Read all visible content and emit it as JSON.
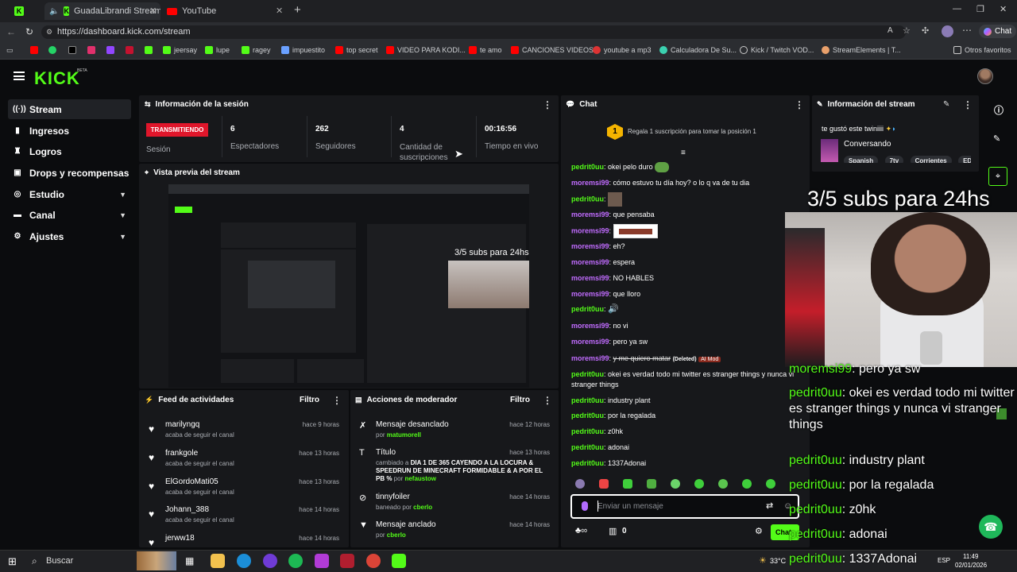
{
  "browser": {
    "tabs": [
      {
        "title": "GuadaLibrandi Stream - Watc",
        "icon": "kick-favicon"
      },
      {
        "title": "YouTube",
        "icon": "youtube-favicon"
      }
    ],
    "url": "https://dashboard.kick.com/stream",
    "bookmarks": [
      "jeersay",
      "lupe",
      "ragey",
      "impuestito",
      "top secret",
      "VIDEO PARA KODI...",
      "te amo",
      "CANCIONES VIDEOS",
      "youtube a mp3",
      "Calculadora De Su...",
      "Kick / Twitch VOD...",
      "StreamElements | T..."
    ],
    "other_bookmarks": "Otros favoritos",
    "chat_btn": "Chat"
  },
  "app": {
    "logo": "KICK",
    "beta": "BETA"
  },
  "sidebar": {
    "items": [
      {
        "label": "Stream",
        "icon": "stream-icon",
        "expand": false
      },
      {
        "label": "Ingresos",
        "icon": "revenue-icon",
        "expand": false
      },
      {
        "label": "Logros",
        "icon": "trophy-icon",
        "expand": false
      },
      {
        "label": "Drops y recompensas",
        "icon": "gift-icon",
        "expand": false
      },
      {
        "label": "Estudio",
        "icon": "studio-icon",
        "expand": true
      },
      {
        "label": "Canal",
        "icon": "channel-icon",
        "expand": true
      },
      {
        "label": "Ajustes",
        "icon": "gear-icon",
        "expand": true
      }
    ]
  },
  "session": {
    "title": "Información de la sesión",
    "status_badge": "TRANSMITIENDO",
    "session_label": "Sesión",
    "stats": [
      {
        "value": "6",
        "label": "Espectadores"
      },
      {
        "value": "262",
        "label": "Seguidores"
      },
      {
        "value": "4",
        "label": "Cantidad de suscripciones"
      },
      {
        "value": "00:16:56",
        "label": "Tiempo en vivo"
      }
    ]
  },
  "preview": {
    "title": "Vista previa del stream"
  },
  "activity": {
    "title": "Feed de actividades",
    "filter": "Filtro",
    "items": [
      {
        "name": "marilyngq",
        "action": "acaba de seguir el canal",
        "time": "hace 9 horas"
      },
      {
        "name": "frankgole",
        "action": "acaba de seguir el canal",
        "time": "hace 13 horas"
      },
      {
        "name": "ElGordoMati05",
        "action": "acaba de seguir el canal",
        "time": "hace 13 horas"
      },
      {
        "name": "Johann_388",
        "action": "acaba de seguir el canal",
        "time": "hace 14 horas"
      },
      {
        "name": "jerww18",
        "action": "",
        "time": "hace 14 horas"
      }
    ]
  },
  "moderation": {
    "title": "Acciones de moderador",
    "filter": "Filtro",
    "items": [
      {
        "title": "Mensaje desanclado",
        "pre": "por ",
        "user": "matumorell",
        "time": "hace 12 horas"
      },
      {
        "title": "Título",
        "pre": "cambiado a ",
        "bold": "DIA 1 DE 365 CAYENDO A LA LOCURA & SPEEDRUN DE MINECRAFT FORMIDABLE & A POR EL PB %",
        "mid": " por ",
        "user": "nefaustow",
        "time": "hace 13 horas"
      },
      {
        "title": "tinnyfoiler",
        "pre": "baneado por ",
        "user": "cberlo",
        "time": "hace 14 horas"
      },
      {
        "title": "Mensaje anclado",
        "pre": "por ",
        "user": "cberlo",
        "time": "hace 14 horas"
      }
    ]
  },
  "chat": {
    "title": "Chat",
    "gift_banner": "Regala 1 suscripción para tomar la posición 1",
    "rank": "1",
    "messages": [
      {
        "user": "pedrit0uu",
        "text": "okei pelo duro"
      },
      {
        "user": "moremsi99",
        "text": "cómo estuvo tu día hoy? o lo q va de tu dia"
      },
      {
        "user": "pedrit0uu",
        "text": ""
      },
      {
        "user": "moremsi99",
        "text": "que pensaba"
      },
      {
        "user": "moremsi99",
        "text": ""
      },
      {
        "user": "moremsi99",
        "text": "eh?"
      },
      {
        "user": "moremsi99",
        "text": "espera"
      },
      {
        "user": "moremsi99",
        "text": "NO HABLES"
      },
      {
        "user": "moremsi99",
        "text": "que llorо"
      },
      {
        "user": "pedrit0uu",
        "text": ""
      },
      {
        "user": "moremsi99",
        "text": "no vi"
      },
      {
        "user": "moremsi99",
        "text": "pero ya sw"
      },
      {
        "user": "moremsi99",
        "text": "y me quiero matar",
        "deleted": "(Deleted)",
        "badge": "AI Mod"
      },
      {
        "user": "pedrit0uu",
        "text": "okei es verdad todo mi twitter es stranger things y nunca vi stranger things"
      },
      {
        "user": "pedrit0uu",
        "text": "industry plant"
      },
      {
        "user": "pedrit0uu",
        "text": "por la regalada"
      },
      {
        "user": "pedrit0uu",
        "text": "z0hk"
      },
      {
        "user": "pedrit0uu",
        "text": "adonai"
      },
      {
        "user": "pedrit0uu",
        "text": "1337Adonai"
      }
    ],
    "input_placeholder": "Enviar un mensaje",
    "points": "0",
    "send": "Chat"
  },
  "stream_info": {
    "title": "Información del stream",
    "stream_title": "te gustó este twiniiii",
    "category": "Conversando",
    "tags": [
      "Spanish",
      "7tv",
      "Corrientes",
      "EDDIE"
    ]
  },
  "overlay": {
    "goal": "3/5 subs para 24hs",
    "lines": [
      {
        "user": "moremsi99",
        "text": "pero ya sw"
      },
      {
        "user": "pedrit0uu",
        "text": "okei es verdad todo mi twitter es stranger things y nunca vi stranger things"
      },
      {
        "user": "pedrit0uu",
        "text": "industry plant"
      },
      {
        "user": "pedrit0uu",
        "text": "por la regalada"
      },
      {
        "user": "pedrit0uu",
        "text": "z0hk"
      },
      {
        "user": "pedrit0uu",
        "text": "adonai"
      },
      {
        "user": "pedrit0uu",
        "text": "1337Adonai"
      }
    ]
  },
  "taskbar": {
    "search": "Buscar",
    "temp": "33°C",
    "lang": "ESP",
    "time": "11:49",
    "date": "02/01/2026"
  },
  "colors": {
    "accent": "#53fc18",
    "live": "#e0162b",
    "bg": "#0b0c0e",
    "panel": "#17181b",
    "user_purple": "#c16cff"
  }
}
